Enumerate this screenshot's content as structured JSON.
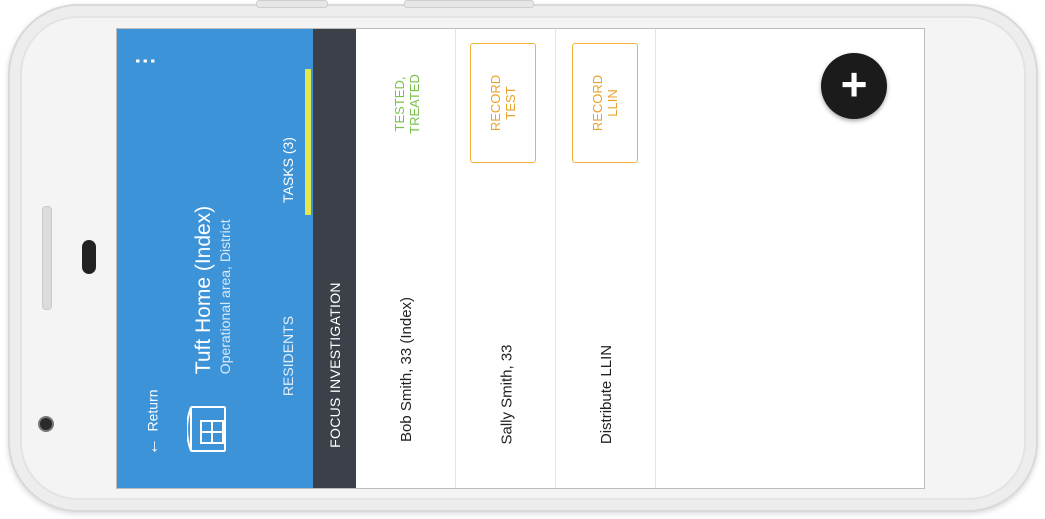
{
  "header": {
    "more_icon": "⋮",
    "return_label": "Return",
    "title": "Tuft Home (Index)",
    "subtitle": "Operational area, District"
  },
  "tabs": [
    {
      "label": "RESIDENTS",
      "active": false
    },
    {
      "label": "TASKS (3)",
      "active": true
    }
  ],
  "section_title": "FOCUS INVESTIGATION",
  "tasks": [
    {
      "name": "Bob Smith, 33 (Index)",
      "status_line1": "TESTED,",
      "status_line2": "TREATED"
    },
    {
      "name": "Sally Smith, 33",
      "action_line1": "RECORD",
      "action_line2": "TEST"
    },
    {
      "name": "Distribute LLIN",
      "action_line1": "RECORD",
      "action_line2": "LLIN"
    }
  ],
  "fab_icon": "+",
  "colors": {
    "header": "#3d93d8",
    "band": "#3c4149",
    "tab_indicator": "#e3e64c",
    "status_green": "#78c24a",
    "action_orange": "#e8a22e",
    "fab": "#1b1b1b"
  }
}
